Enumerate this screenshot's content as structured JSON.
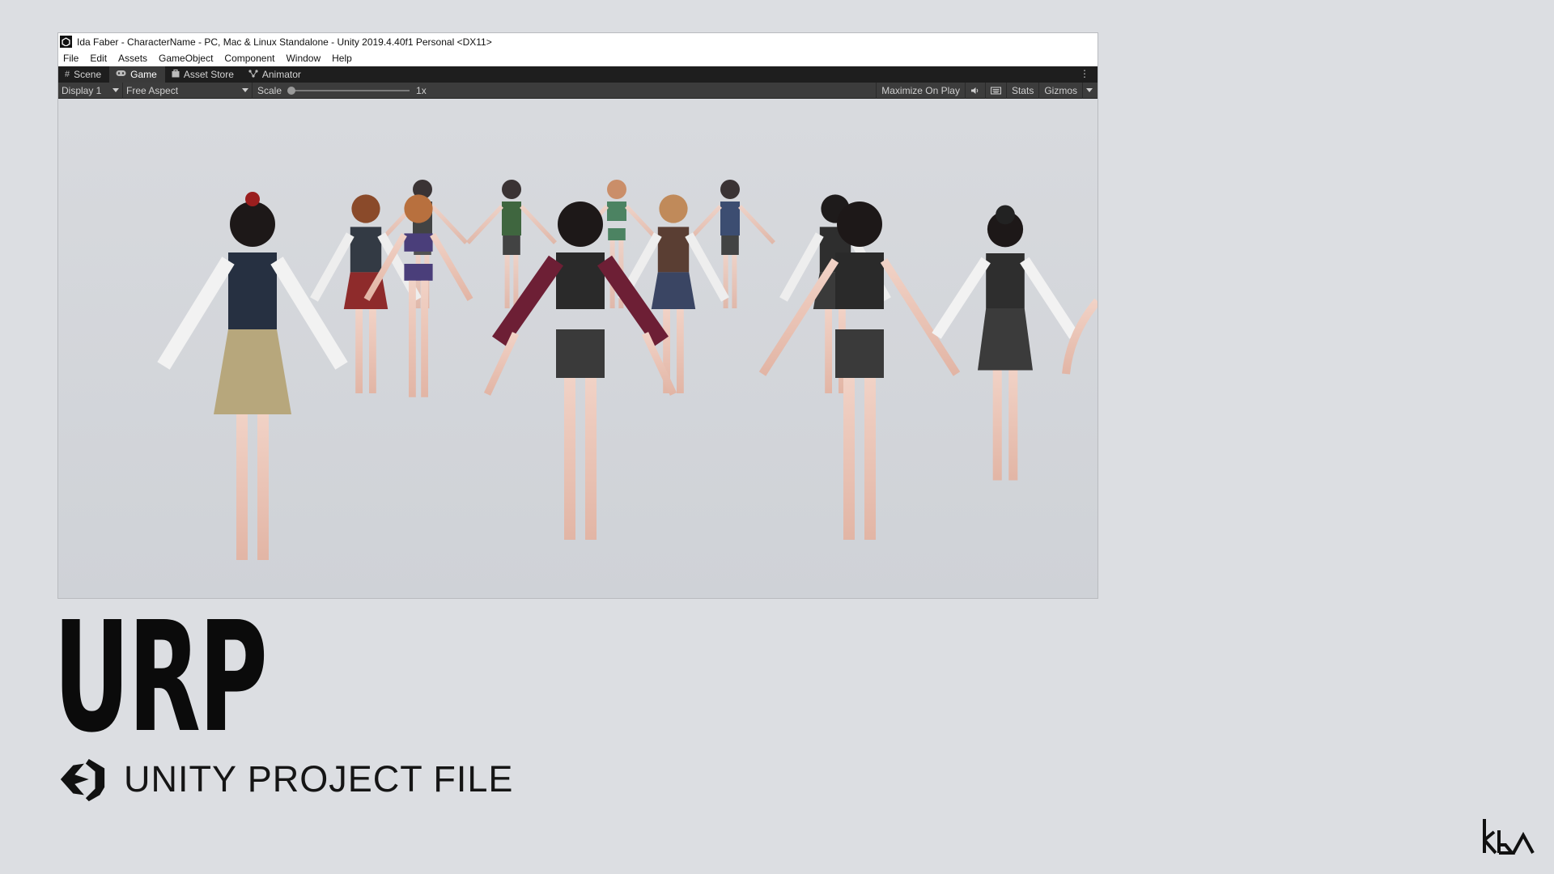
{
  "window": {
    "title": "Ida Faber - CharacterName - PC, Mac & Linux Standalone - Unity 2019.4.40f1 Personal <DX11>",
    "menu": [
      "File",
      "Edit",
      "Assets",
      "GameObject",
      "Component",
      "Window",
      "Help"
    ],
    "tabs": [
      {
        "label": "Scene",
        "icon": "grid-icon"
      },
      {
        "label": "Game",
        "icon": "gamepad-icon",
        "active": true
      },
      {
        "label": "Asset Store",
        "icon": "store-icon"
      },
      {
        "label": "Animator",
        "icon": "animator-icon"
      }
    ]
  },
  "toolbar": {
    "display": "Display 1",
    "aspect": "Free Aspect",
    "scale_label": "Scale",
    "scale_value": "1x",
    "maximize": "Maximize On Play",
    "stats": "Stats",
    "gizmos": "Gizmos"
  },
  "caption": {
    "title": "URP",
    "subtitle": "UNITY PROJECT FILE"
  },
  "colors": {
    "background": "#dcdee2",
    "tabbar": "#1e1e1e",
    "toolbar": "#3c3c3c"
  }
}
